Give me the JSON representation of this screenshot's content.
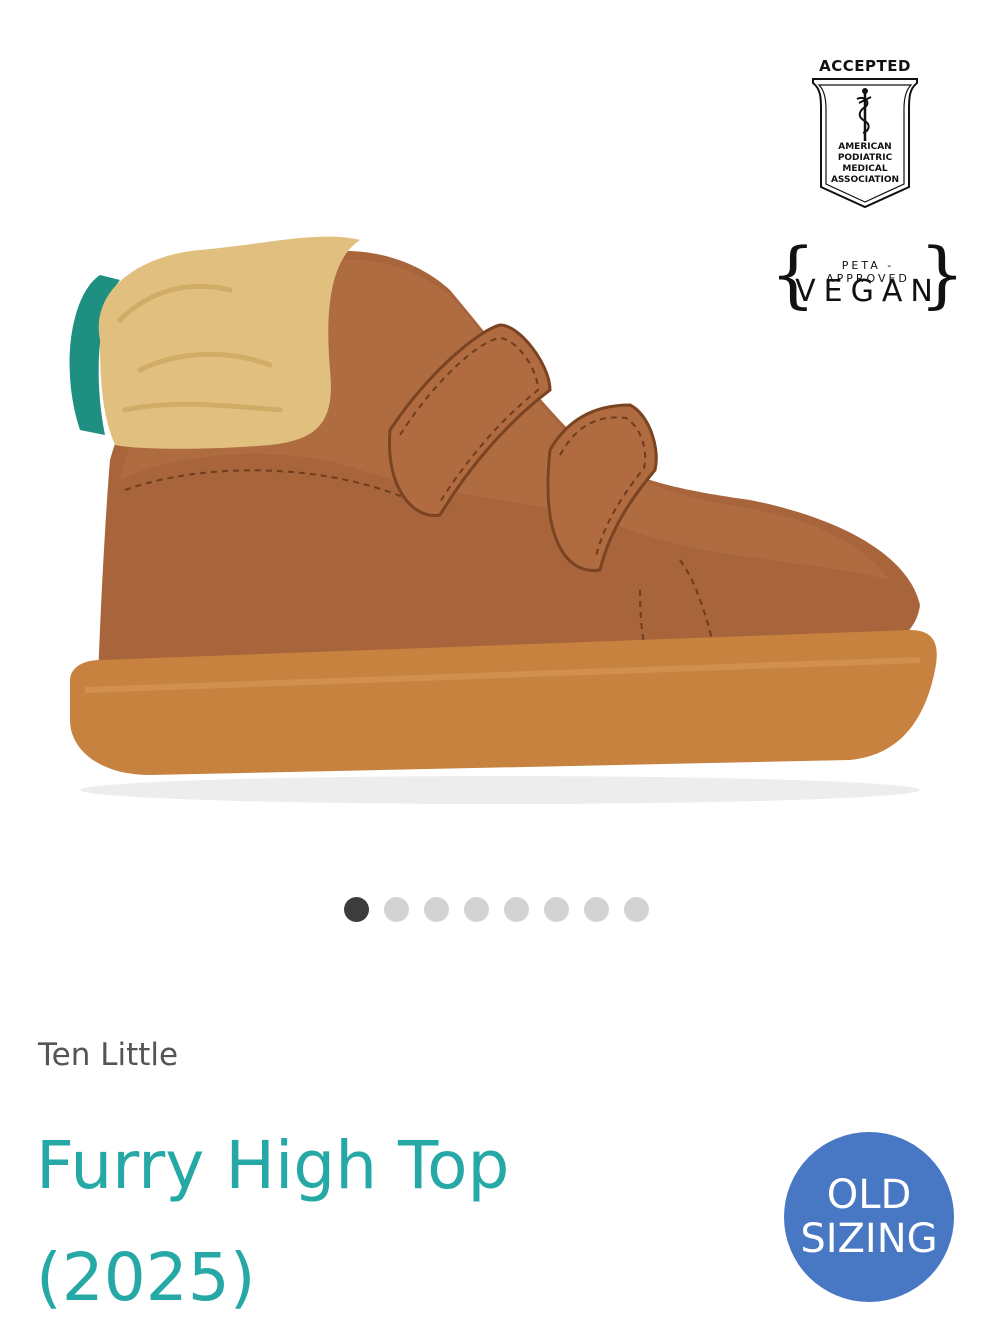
{
  "badges": {
    "apma": {
      "accepted": "ACCEPTED",
      "line1": "AMERICAN",
      "line2": "PODIATRIC",
      "line3": "MEDICAL",
      "line4": "ASSOCIATION"
    },
    "peta": {
      "top": "PETA - APPROVED",
      "word": "VEGAN"
    }
  },
  "gallery": {
    "total_slides": 8,
    "active_index": 0
  },
  "product": {
    "brand": "Ten Little",
    "title_line1": "Furry High Top",
    "title_line2": "(2025)",
    "sizing_badge_line1": "OLD",
    "sizing_badge_line2": "SIZING"
  },
  "colors": {
    "title": "#26a9a6",
    "sizing_badge": "#4877c4",
    "dot_active": "#3c3c3c",
    "dot_inactive": "#d3d3d3"
  }
}
